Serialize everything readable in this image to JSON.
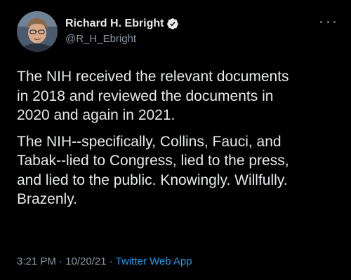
{
  "author": {
    "display_name": "Richard H. Ebright",
    "handle": "@R_H_Ebright",
    "verified": true,
    "avatar_icon": "profile-photo"
  },
  "tweet": {
    "paragraphs": [
      "The NIH received the relevant documents\nin 2018 and reviewed the documents in\n2020 and again in 2021.",
      "The NIH--specifically, Collins, Fauci, and\nTabak--lied to Congress, lied to the press,\nand lied to the public. Knowingly. Willfully.\nBrazenly."
    ]
  },
  "meta": {
    "time": "3:21 PM",
    "separator1": " · ",
    "date": "10/20/21",
    "separator2": " · ",
    "source": "Twitter Web App"
  },
  "colors": {
    "background": "#000000",
    "text_primary": "#e7e9ea",
    "text_secondary": "#8b98a5",
    "accent": "#1d9bf0"
  }
}
